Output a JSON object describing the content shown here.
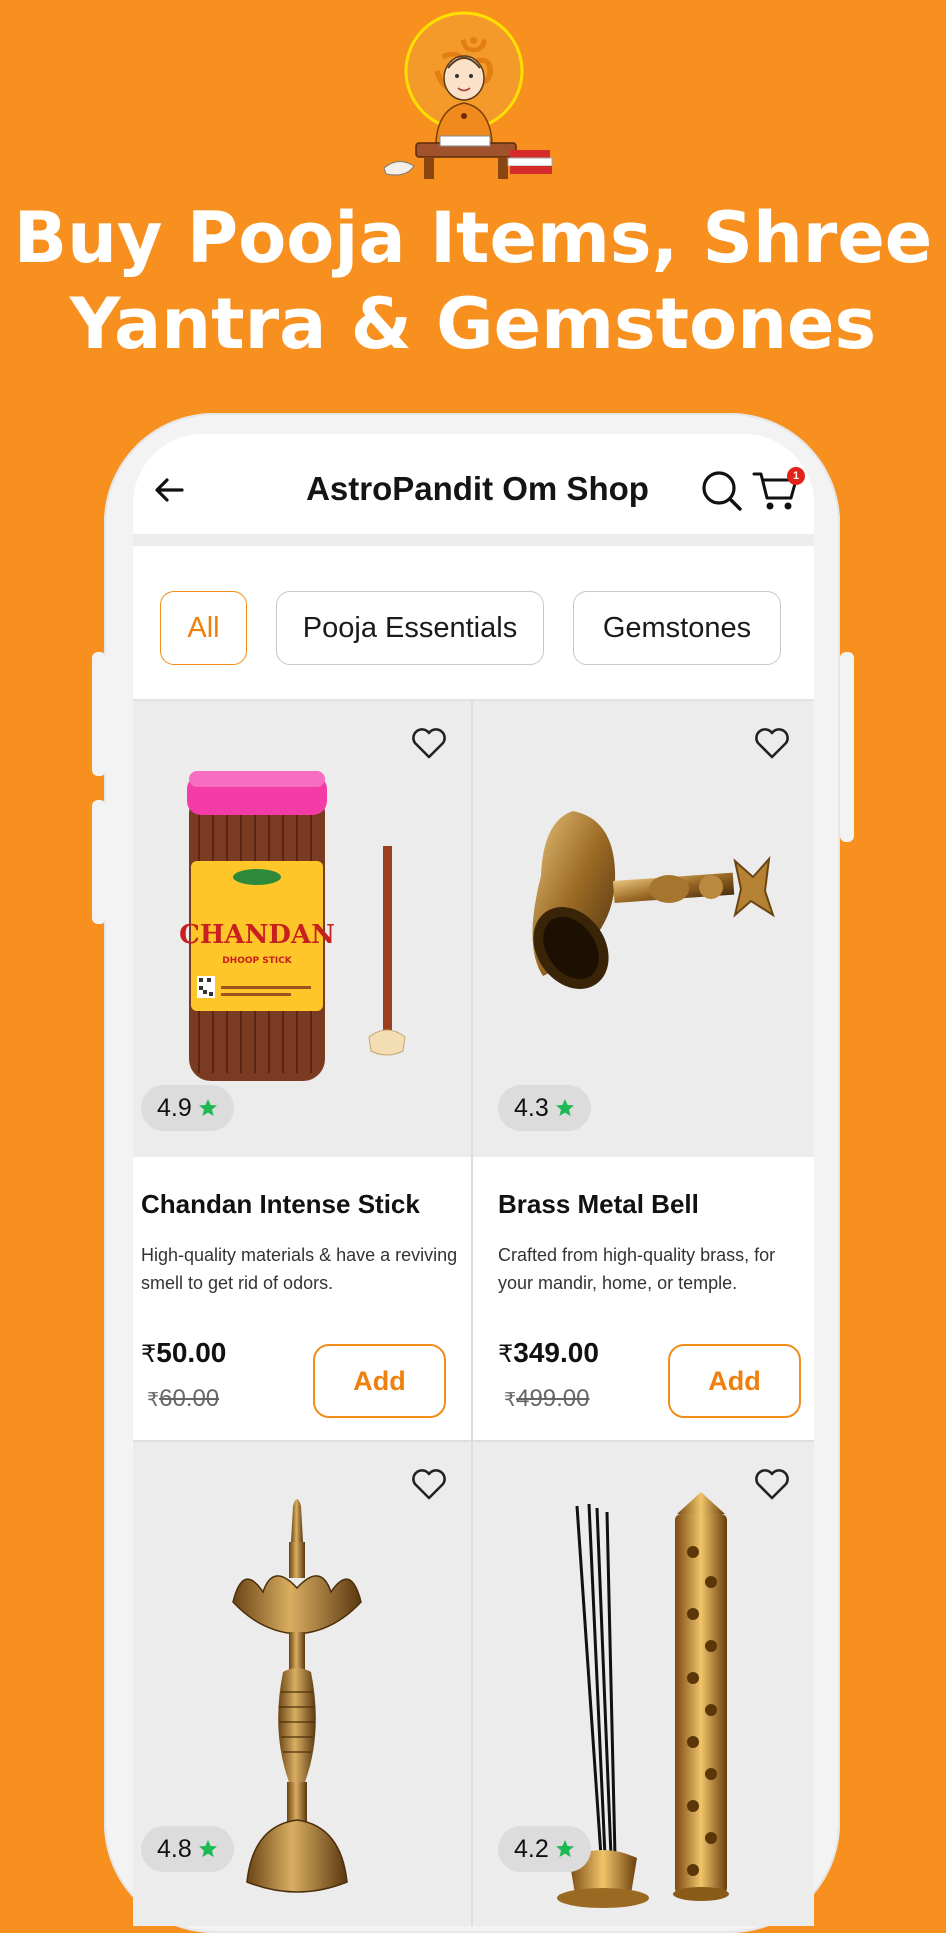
{
  "promo": {
    "headline_line1": "Buy Pooja Items, Shree",
    "headline_line2": "Yantra & Gemstones"
  },
  "colors": {
    "background": "#F7901E",
    "accent": "#F28C1A",
    "rating_star": "#1DB954"
  },
  "appbar": {
    "title": "AstroPandit Om Shop",
    "cart_count": "1",
    "icons": [
      "back-arrow-icon",
      "search-icon",
      "cart-icon"
    ]
  },
  "filters": {
    "items": [
      {
        "label": "All",
        "active": true
      },
      {
        "label": "Pooja Essentials",
        "active": false
      },
      {
        "label": "Gemstones",
        "active": false
      }
    ]
  },
  "products": [
    {
      "name": "Chandan Intense Stick",
      "description": "High-quality materials & have a reviving smell to get rid of odors.",
      "price": "50.00",
      "mrp": "60.00",
      "rating": "4.9",
      "add_label": "Add",
      "currency": "₹",
      "image_text": "CHANDAN",
      "image_subtext": "DHOOP STICK"
    },
    {
      "name": "Brass Metal Bell",
      "description": "Crafted from high-quality brass, for your mandir, home, or temple.",
      "price": "349.00",
      "mrp": "499.00",
      "rating": "4.3",
      "add_label": "Add",
      "currency": "₹"
    },
    {
      "rating": "4.8"
    },
    {
      "rating": "4.2"
    }
  ]
}
